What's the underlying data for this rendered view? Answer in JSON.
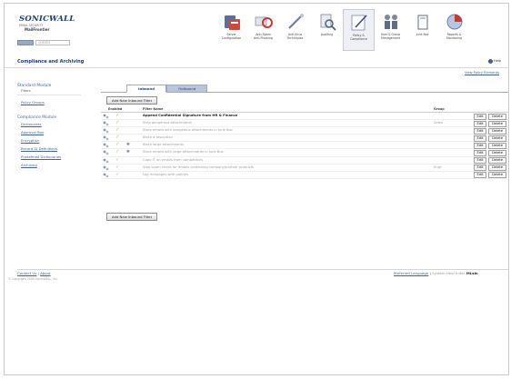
{
  "logo": {
    "brand": "SONICWALL",
    "tagline": "EMAIL SECURITY",
    "product": "MailFrontier"
  },
  "user": {
    "field_text": "QUEUES"
  },
  "toolbar": [
    {
      "label": "Server\nConfiguration",
      "icon": "server-config-icon"
    },
    {
      "label": "Anti-Spam\nAnti-Phishing",
      "icon": "anti-spam-icon"
    },
    {
      "label": "Anti-Virus\nTechniques",
      "icon": "anti-virus-icon"
    },
    {
      "label": "Auditing",
      "icon": "auditing-icon"
    },
    {
      "label": "Policy &\nCompliance",
      "icon": "policy-icon"
    },
    {
      "label": "User & Group\nManagement",
      "icon": "users-icon"
    },
    {
      "label": "Junk Box",
      "icon": "junk-box-icon"
    },
    {
      "label": "Reports &\nMonitoring",
      "icon": "reports-icon"
    }
  ],
  "page": {
    "title": "Compliance and Archiving",
    "help": "Help",
    "view_link": "View Policy Elements"
  },
  "nav": {
    "standard_head": "Standard Module",
    "standard_sub": "Filters",
    "standard_links": [
      "Policy Groups"
    ],
    "compliance_head": "Compliance Module",
    "compliance_links": [
      "Dictionaries",
      "Approval Box",
      "Encryption",
      "Record ID Definitions",
      "Predefined Dictionaries",
      "Archiving"
    ]
  },
  "tabs": {
    "inbound": "Inbound",
    "outbound": "Outbound"
  },
  "buttons": {
    "add_top": "Add New Inbound Filter",
    "add_bottom": "Add New Inbound Filter"
  },
  "table": {
    "headers": {
      "enabled": "Enabled",
      "filter_name": "Filter Name",
      "group": "Group"
    },
    "rows": [
      {
        "name": "Append Confidential Signature from HR & Finance",
        "group": "",
        "bold": true,
        "star": false
      },
      {
        "name": "Strip dangerous attachments",
        "group": "Sales",
        "bold": false,
        "star": false
      },
      {
        "name": "Store emails with dangerous attachments in Junk Box",
        "group": "",
        "bold": false,
        "star": false
      },
      {
        "name": "Block a resolution",
        "group": "",
        "bold": false,
        "star": false
      },
      {
        "name": "Block large attachments",
        "group": "",
        "bold": false,
        "star": true
      },
      {
        "name": "Store emails with large attachments in Junk Box",
        "group": "",
        "bold": false,
        "star": true
      },
      {
        "name": "Copy IT on emails from competitors",
        "group": "",
        "bold": false,
        "star": false
      },
      {
        "name": "Stop spam check for emails containing company/partner products",
        "group": "Engr",
        "bold": false,
        "star": false
      },
      {
        "name": "Log messages with policies",
        "group": "",
        "bold": false,
        "star": false
      }
    ],
    "edit_label": "Edit",
    "delete_label": "Delete"
  },
  "footer": {
    "contact": "Contact Us",
    "separator": "|",
    "about": "About",
    "copyright": "© Copyright 2005 SonicWALL, Inc.",
    "pref_lang": "Preferred Language",
    "separator2": "|",
    "lang_sel": "System Help Index",
    "user": "MLsin"
  },
  "colors": {
    "brand": "#1f3a75",
    "link": "#3e62a8",
    "tab_inactive": "#b9c5db",
    "enabled_check": "#9bc46a"
  }
}
